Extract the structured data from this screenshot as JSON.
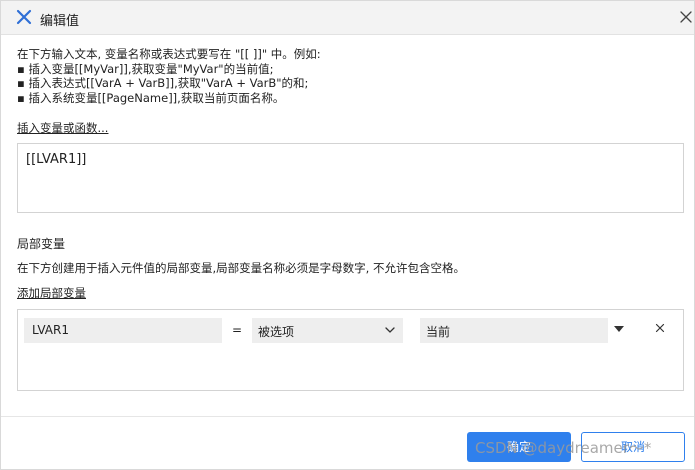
{
  "dialog": {
    "title": "编辑值",
    "instructions": [
      "在下方输入文本, 变量名称或表达式要写在 \"[[ ]]\" 中。例如:",
      "▪ 插入变量[[MyVar]],获取变量\"MyVar\"的当前值;",
      "▪ 插入表达式[[VarA + VarB]],获取\"VarA + VarB\"的和;",
      "▪ 插入系统变量[[PageName]],获取当前页面名称。"
    ],
    "insert_link": "插入变量或函数...",
    "expression_value": "[[LVAR1]]"
  },
  "local_vars": {
    "section_title": "局部变量",
    "description": "在下方创建用于插入元件值的局部变量,局部变量名称必须是字母数字, 不允许包含空格。",
    "add_link": "添加局部变量",
    "rows": [
      {
        "name": "LVAR1",
        "equals": "=",
        "type": "被选项",
        "value": "当前",
        "remove": "×"
      }
    ]
  },
  "footer": {
    "ok_label": "确定",
    "cancel_label": "取消"
  },
  "watermark": "CSDN @daydreamer～*",
  "colors": {
    "accent": "#2f80ed",
    "app_icon": "#2f6fd6"
  },
  "icons": {
    "app": "axure-x-icon",
    "close": "close-icon",
    "type_dropdown": "chevron-down-icon",
    "value_dropdown": "caret-down-icon",
    "remove_row": "close-icon"
  }
}
